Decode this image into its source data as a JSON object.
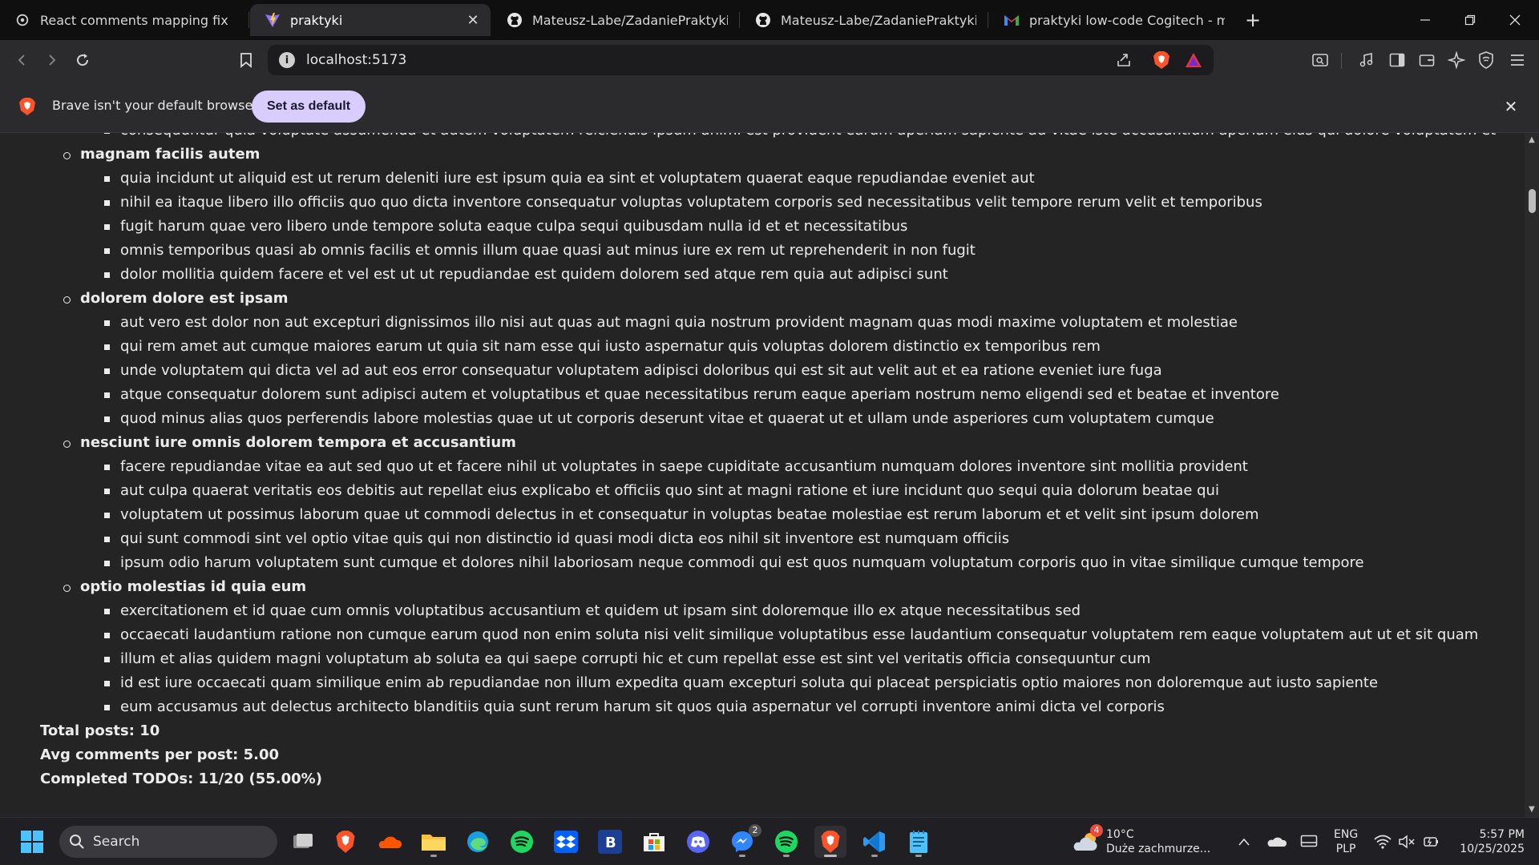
{
  "browser": {
    "tabs": [
      {
        "title": "React comments mapping fix",
        "icon": "openai-icon",
        "active": false
      },
      {
        "title": "praktyki",
        "icon": "vite-icon",
        "active": true
      },
      {
        "title": "Mateusz-Labe/ZadaniePraktyki",
        "icon": "github-icon",
        "active": false
      },
      {
        "title": "Mateusz-Labe/ZadaniePraktyki",
        "icon": "github-icon",
        "active": false
      },
      {
        "title": "praktyki low-code Cogitech - mati.lab",
        "icon": "gmail-icon",
        "active": false
      }
    ],
    "url": "localhost:5173",
    "infobar": {
      "message": "Brave isn't your default browser",
      "button": "Set as default"
    }
  },
  "page": {
    "cut_line": "consequuntur quia voluptate assumenda et autem voluptatem reiciendis ipsum animi est provident earum aperiam sapiente ad vitae iste accusantium aperiam eius qui dolore voluptatem et",
    "posts": [
      {
        "title": "magnam facilis autem",
        "comments": [
          "quia incidunt ut aliquid est ut rerum deleniti iure est ipsum quia ea sint et voluptatem quaerat eaque repudiandae eveniet aut",
          "nihil ea itaque libero illo officiis quo quo dicta inventore consequatur voluptas voluptatem corporis sed necessitatibus velit tempore rerum velit et temporibus",
          "fugit harum quae vero libero unde tempore soluta eaque culpa sequi quibusdam nulla id et et necessitatibus",
          "omnis temporibus quasi ab omnis facilis et omnis illum quae quasi aut minus iure ex rem ut reprehenderit in non fugit",
          "dolor mollitia quidem facere et vel est ut ut repudiandae est quidem dolorem sed atque rem quia aut adipisci sunt"
        ]
      },
      {
        "title": "dolorem dolore est ipsam",
        "comments": [
          "aut vero est dolor non aut excepturi dignissimos illo nisi aut quas aut magni quia nostrum provident magnam quas modi maxime voluptatem et molestiae",
          "qui rem amet aut cumque maiores earum ut quia sit nam esse qui iusto aspernatur quis voluptas dolorem distinctio ex temporibus rem",
          "unde voluptatem qui dicta vel ad aut eos error consequatur voluptatem adipisci doloribus qui est sit aut velit aut et ea ratione eveniet iure fuga",
          "atque consequatur dolorem sunt adipisci autem et voluptatibus et quae necessitatibus rerum eaque aperiam nostrum nemo eligendi sed et beatae et inventore",
          "quod minus alias quos perferendis labore molestias quae ut ut corporis deserunt vitae et quaerat ut et ullam unde asperiores cum voluptatem cumque"
        ]
      },
      {
        "title": "nesciunt iure omnis dolorem tempora et accusantium",
        "comments": [
          "facere repudiandae vitae ea aut sed quo ut et facere nihil ut voluptates in saepe cupiditate accusantium numquam dolores inventore sint mollitia provident",
          "aut culpa quaerat veritatis eos debitis aut repellat eius explicabo et officiis quo sint at magni ratione et iure incidunt quo sequi quia dolorum beatae qui",
          "voluptatem ut possimus laborum quae ut commodi delectus in et consequatur in voluptas beatae molestiae est rerum laborum et et velit sint ipsum dolorem",
          "qui sunt commodi sint vel optio vitae quis qui non distinctio id quasi modi dicta eos nihil sit inventore est numquam officiis",
          "ipsum odio harum voluptatem sunt cumque et dolores nihil laboriosam neque commodi qui est quos numquam voluptatum corporis quo in vitae similique cumque tempore"
        ]
      },
      {
        "title": "optio molestias id quia eum",
        "comments": [
          "exercitationem et id quae cum omnis voluptatibus accusantium et quidem ut ipsam sint doloremque illo ex atque necessitatibus sed",
          "occaecati laudantium ratione non cumque earum quod non enim soluta nisi velit similique voluptatibus esse laudantium consequatur voluptatem rem eaque voluptatem aut ut et sit quam",
          "illum et alias quidem magni voluptatum ab soluta ea qui saepe corrupti hic et cum repellat esse est sint vel veritatis officia consequuntur cum",
          "id est iure occaecati quam similique enim ab repudiandae non illum expedita quam excepturi soluta qui placeat perspiciatis optio maiores non doloremque aut iusto sapiente",
          "eum accusamus aut delectus architecto blanditiis quia sunt rerum harum sit quos quia aspernatur vel corrupti inventore animi dicta vel corporis"
        ]
      }
    ],
    "stats": [
      "Total posts: 10",
      "Avg comments per post: 5.00",
      "Completed TODOs: 11/20 (55.00%)"
    ]
  },
  "taskbar": {
    "search_label": "Search",
    "apps": [
      "windows-start-icon",
      "task-view-icon",
      "brave-icon",
      "soundcloud-icon",
      "file-explorer-icon",
      "edge-icon",
      "spotify-icon",
      "dropbox-icon",
      "b-app-icon",
      "microsoft-store-icon",
      "discord-icon",
      "messenger-icon",
      "spotify-icon",
      "brave-icon",
      "vscode-icon",
      "notepad-icon"
    ],
    "messenger_badge": "2",
    "weather": {
      "badge": "4",
      "temp": "10°C",
      "desc": "Duże zachmurze..."
    },
    "lang": {
      "line1": "ENG",
      "line2": "PLP"
    },
    "clock": {
      "time": "5:57 PM",
      "date": "10/25/2025"
    }
  },
  "colors": {
    "page_bg": "#242424",
    "text": "#ececec",
    "accent_button": "#d9ccff",
    "brave_orange": "#fb542b"
  }
}
